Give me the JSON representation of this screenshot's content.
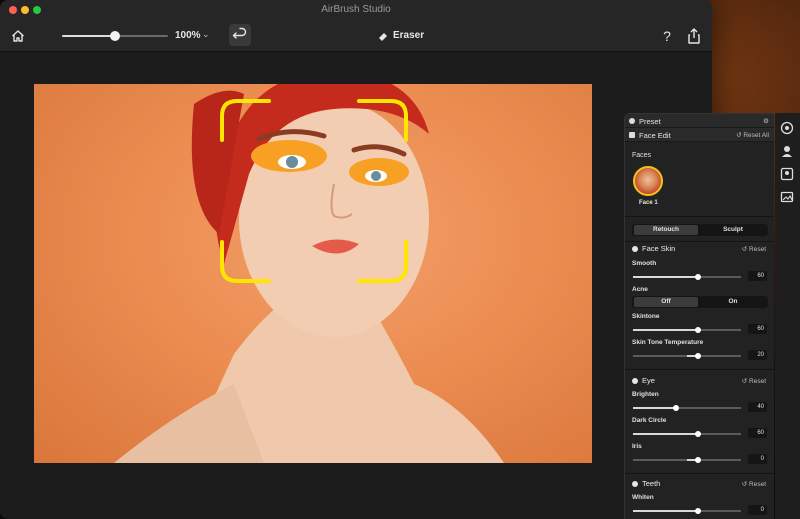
{
  "window": {
    "title": "AirBrush Studio"
  },
  "toolbar": {
    "zoom_value": "100%",
    "zoom_level": 0.5,
    "tool_label": "Eraser"
  },
  "panel": {
    "preset_label": "Preset",
    "face_edit_label": "Face Edit",
    "reset_all_label": "Reset All",
    "faces_label": "Faces",
    "face_name": "Face 1",
    "tabs": [
      {
        "label": "Retouch",
        "active": true
      },
      {
        "label": "Sculpt",
        "active": false
      }
    ],
    "sections": {
      "face_skin": {
        "title": "Face Skin",
        "reset_label": "Reset",
        "smooth": {
          "label": "Smooth",
          "value": "60",
          "fraction": 0.6
        },
        "acne": {
          "label": "Acne",
          "off_label": "Off",
          "on_label": "On",
          "selected": "Off"
        },
        "skintone": {
          "label": "Skintone",
          "value": "60",
          "fraction": 0.6
        },
        "temperature": {
          "label": "Skin Tone Temperature",
          "value": "20",
          "fraction": 0.6
        }
      },
      "eye": {
        "title": "Eye",
        "reset_label": "Reset",
        "brighten": {
          "label": "Brighten",
          "value": "40",
          "fraction": 0.4
        },
        "dark_circle": {
          "label": "Dark Circle",
          "value": "60",
          "fraction": 0.6
        },
        "iris": {
          "label": "Iris",
          "value": "0",
          "fraction": 0.6
        }
      },
      "teeth": {
        "title": "Teeth",
        "reset_label": "Reset",
        "whiten": {
          "label": "Whiten",
          "value": "0",
          "fraction": 0.6
        }
      }
    }
  },
  "colors": {
    "face_frame": "#ffe600",
    "photo_bg": "#ec8d52",
    "panel_bg": "#222222"
  },
  "icons": [
    "home-icon",
    "undo-icon",
    "eraser-icon",
    "help-icon",
    "share-icon",
    "gear-icon",
    "sliders-icon",
    "reset-icon",
    "face-retouch-icon",
    "portrait-icon",
    "face-scan-icon",
    "image-icon"
  ]
}
